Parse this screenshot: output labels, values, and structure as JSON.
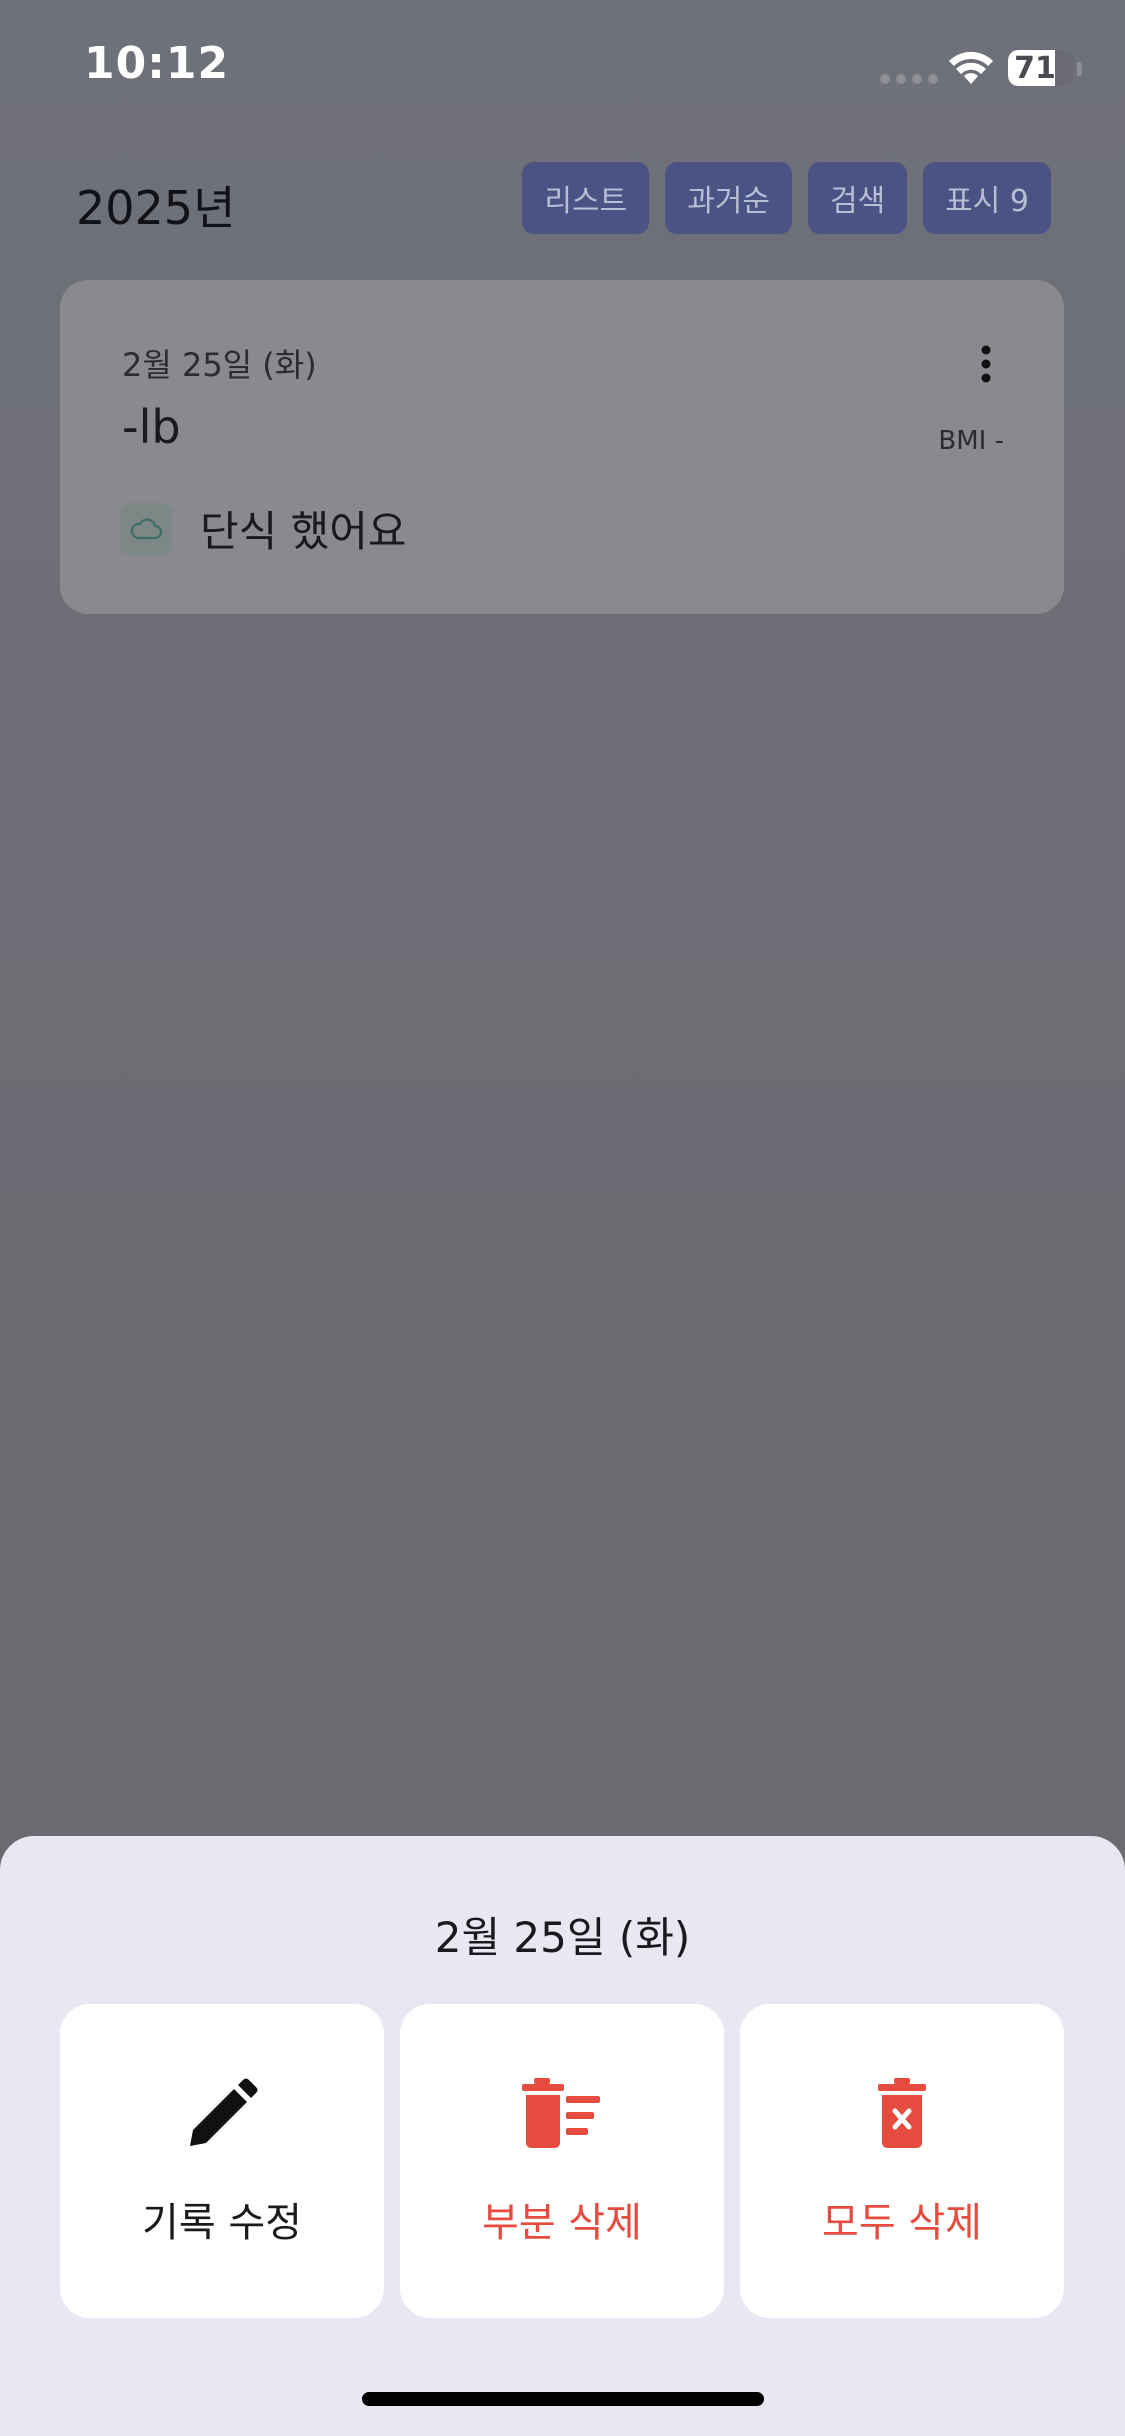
{
  "status_bar": {
    "time": "10:12",
    "battery_level": "71",
    "battery_fraction": 0.71
  },
  "header": {
    "year_title": "2025년",
    "buttons": [
      {
        "label": "리스트"
      },
      {
        "label": "과거순"
      },
      {
        "label": "검색"
      },
      {
        "label": "표시 9"
      }
    ]
  },
  "record": {
    "date": "2월 25일 (화)",
    "weight": "-lb",
    "bmi": "BMI -",
    "memo_icon": "cloud-icon",
    "memo": "단식 했어요"
  },
  "sheet": {
    "title": "2월 25일 (화)",
    "actions": [
      {
        "label": "기록 수정",
        "icon": "pencil-icon",
        "color": "#1a1a1e"
      },
      {
        "label": "부분 삭제",
        "icon": "partial-delete-icon",
        "color": "#e54b3f"
      },
      {
        "label": "모두 삭제",
        "icon": "delete-all-icon",
        "color": "#e54b3f"
      }
    ]
  },
  "colors": {
    "header_button_bg": "#4a5384",
    "danger": "#e54b3f",
    "sheet_bg": "#e7e8f2"
  }
}
